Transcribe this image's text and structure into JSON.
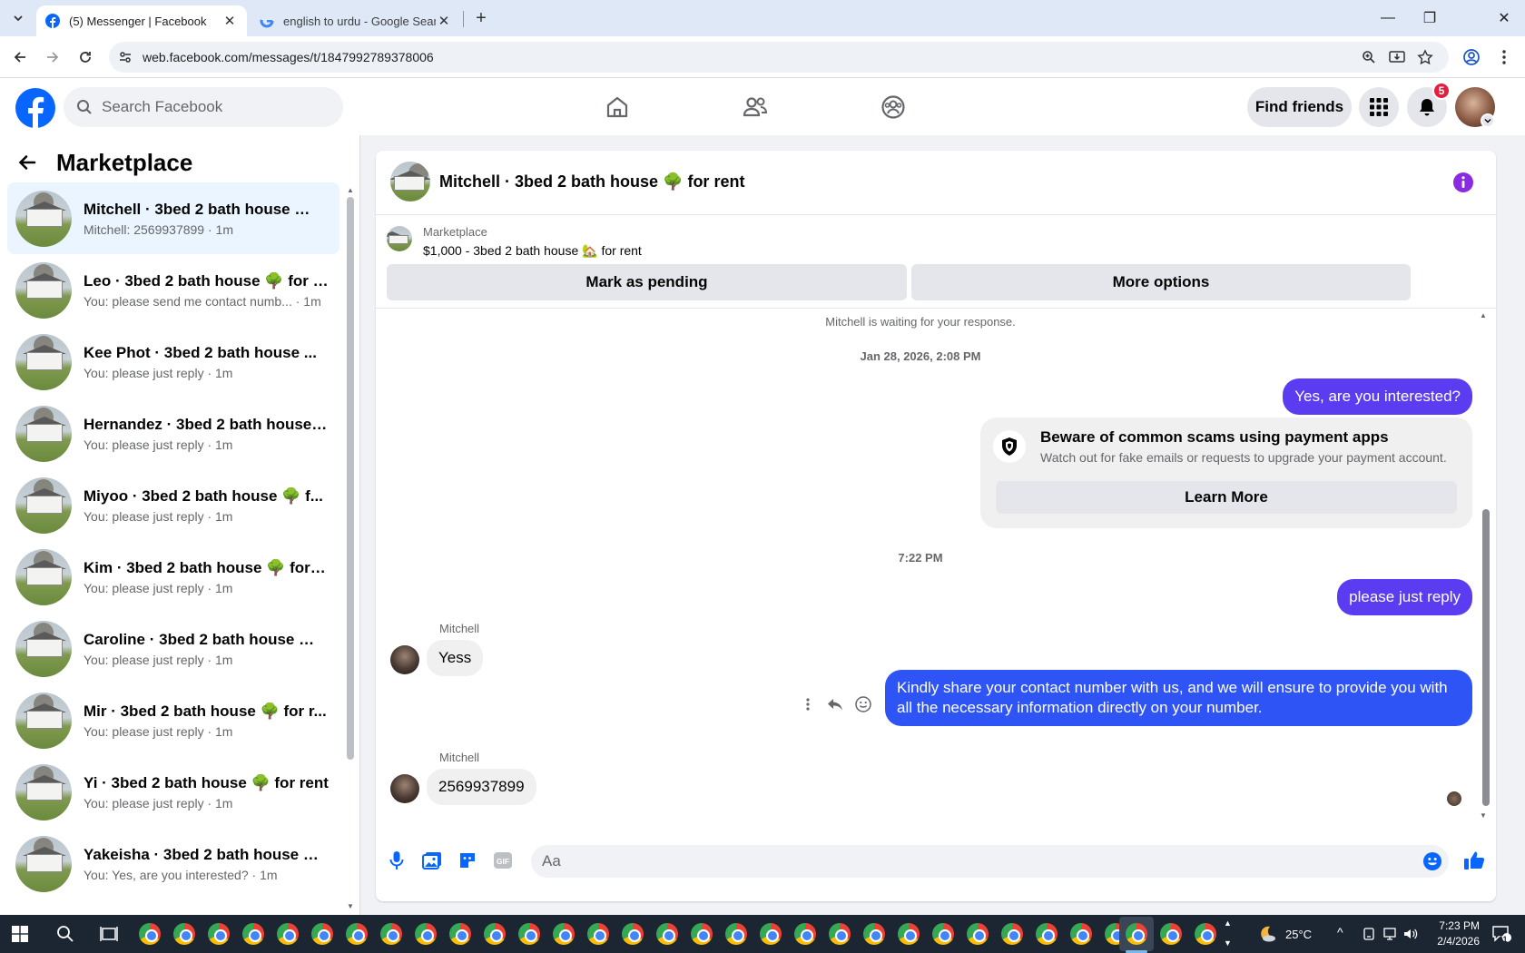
{
  "browser": {
    "tabs": [
      {
        "title": "(5) Messenger | Facebook",
        "active": true,
        "icon": "facebook-icon"
      },
      {
        "title": "english to urdu - Google Search",
        "active": false,
        "icon": "google-icon"
      }
    ],
    "url": "web.facebook.com/messages/t/1847992789378006"
  },
  "fb_header": {
    "search_placeholder": "Search Facebook",
    "find_friends": "Find friends",
    "notification_count": "5",
    "brand_color": "#0866ff"
  },
  "sidebar": {
    "title": "Marketplace",
    "conversations": [
      {
        "name": "Mitchell · 3bed 2 bath house 🌳 ...",
        "preview": "Mitchell: 2569937899 · 1m",
        "active": true
      },
      {
        "name": "Leo · 3bed 2 bath house 🌳 for r...",
        "preview": "You: please send me contact numb... · 1m"
      },
      {
        "name": "Kee Phot · 3bed 2 bath house ...",
        "preview": "You: please just reply · 1m"
      },
      {
        "name": "Hernandez · 3bed 2 bath house ...",
        "preview": "You: please just reply · 1m"
      },
      {
        "name": "Miyoo · 3bed 2 bath house 🌳 f...",
        "preview": "You: please just reply · 1m"
      },
      {
        "name": "Kim · 3bed 2 bath house 🌳 for r...",
        "preview": "You: please just reply · 1m"
      },
      {
        "name": "Caroline · 3bed 2 bath house 🌳 ...",
        "preview": "You: please just reply · 1m"
      },
      {
        "name": "Mir · 3bed 2 bath house 🌳 for r...",
        "preview": "You: please just reply · 1m"
      },
      {
        "name": "Yi · 3bed 2 bath house 🌳 for rent",
        "preview": "You: please just reply · 1m"
      },
      {
        "name": "Yakeisha · 3bed 2 bath house 🌳...",
        "preview": "You: Yes, are you interested? · 1m"
      }
    ]
  },
  "chat": {
    "title": "Mitchell · 3bed 2 bath house 🌳 for rent",
    "listing_source": "Marketplace",
    "listing_price": "$1,000 - 3bed 2 bath house 🏡 for rent",
    "mark_pending": "Mark as pending",
    "more_options": "More options",
    "waiting_note": "Mitchell is waiting for your response.",
    "timestamp1": "Jan 28, 2026, 2:08 PM",
    "msg_out1": "Yes, are you interested?",
    "scam_title": "Beware of common scams using payment apps",
    "scam_desc": "Watch out for fake emails or requests to upgrade your payment account.",
    "learn_more": "Learn More",
    "timestamp2": "7:22 PM",
    "msg_out2": "please just reply",
    "sender1": "Mitchell",
    "msg_in1": "Yess",
    "msg_out3": "Kindly share your contact number with us, and we will ensure to provide you with all the necessary information directly on your number.",
    "sender2": "Mitchell",
    "msg_in2": "2569937899",
    "composer_placeholder": "Aa",
    "accent_color": "#5b3cf0"
  },
  "taskbar": {
    "temperature": "25°C",
    "time": "7:23 PM",
    "date": "2/4/2026",
    "notif_count": "11"
  }
}
